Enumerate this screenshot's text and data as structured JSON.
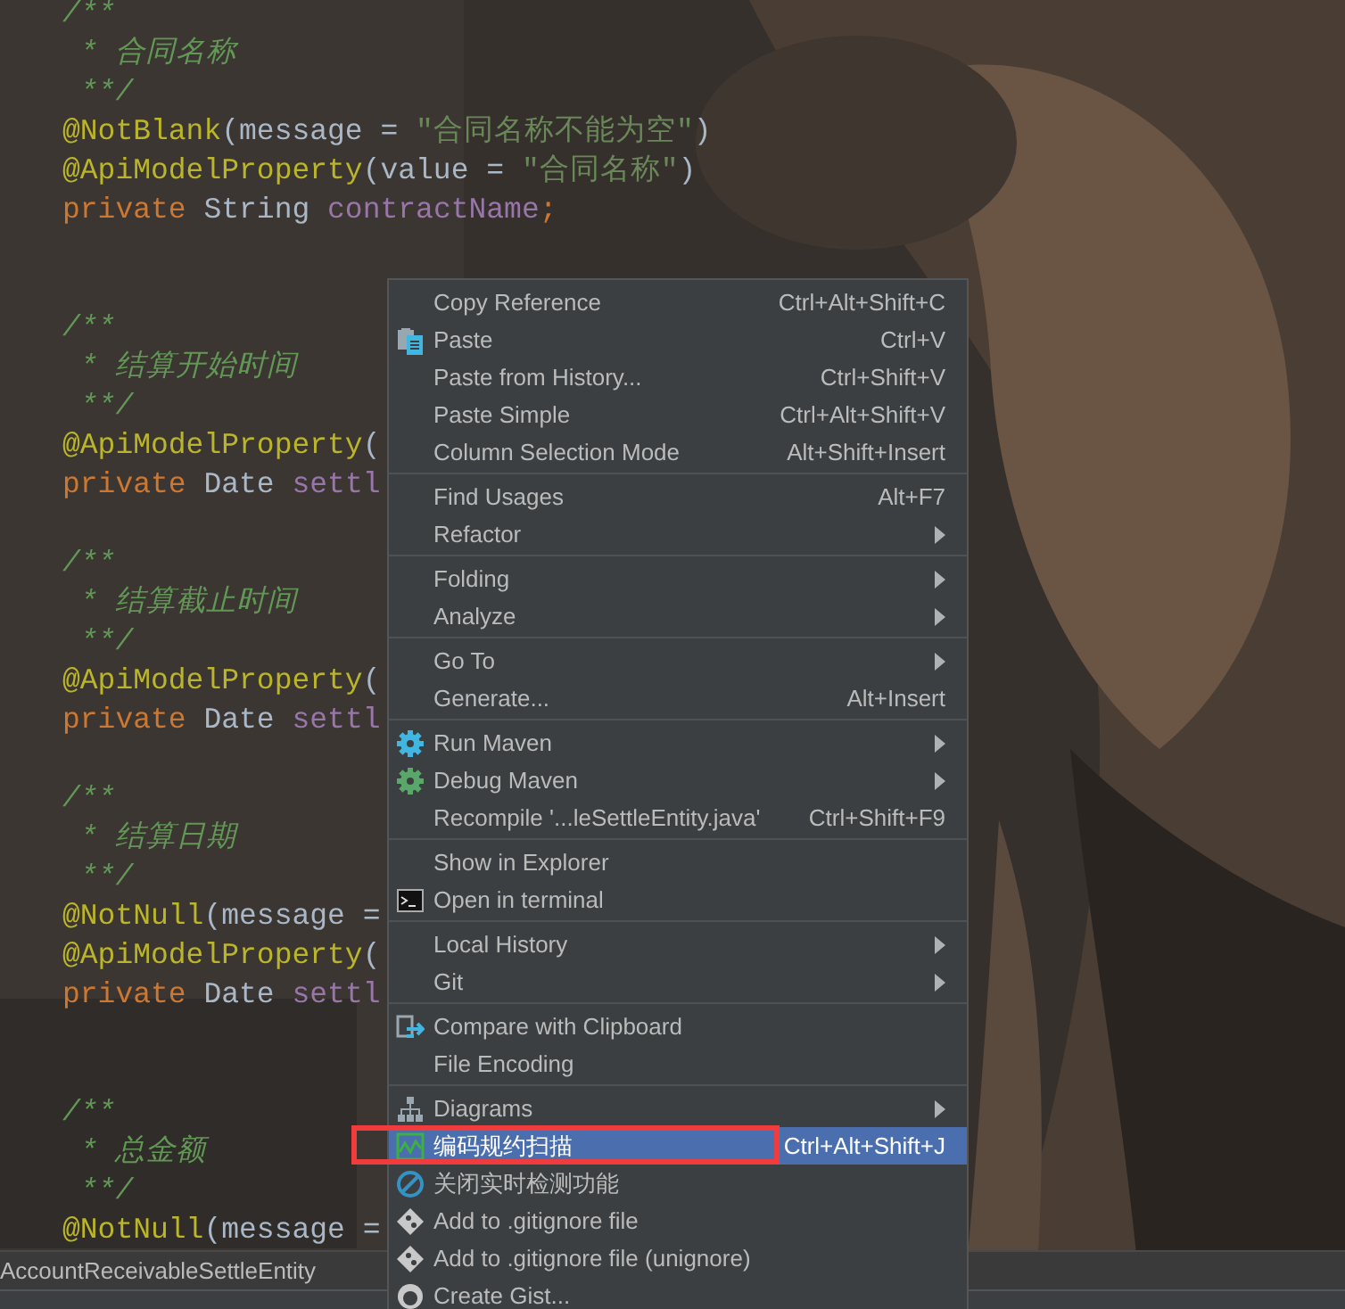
{
  "editor": {
    "lines": [
      {
        "kind": "code",
        "tokens": [
          {
            "kind": "comment",
            "text": "/**"
          }
        ]
      },
      {
        "kind": "code",
        "tokens": [
          {
            "kind": "comment",
            "text": " * 合同名称"
          }
        ]
      },
      {
        "kind": "code",
        "tokens": [
          {
            "kind": "comment",
            "text": " **/"
          }
        ]
      },
      {
        "kind": "code",
        "tokens": [
          {
            "kind": "annotation",
            "text": "@NotBlank"
          },
          {
            "kind": "plain",
            "text": "(message = "
          },
          {
            "kind": "string",
            "text": "\"合同名称不能为空\""
          },
          {
            "kind": "plain",
            "text": ")"
          }
        ]
      },
      {
        "kind": "code",
        "tokens": [
          {
            "kind": "annotation",
            "text": "@ApiModelProperty"
          },
          {
            "kind": "plain",
            "text": "(value = "
          },
          {
            "kind": "string",
            "text": "\"合同名称\""
          },
          {
            "kind": "plain",
            "text": ")"
          }
        ]
      },
      {
        "kind": "code",
        "tokens": [
          {
            "kind": "keyword",
            "text": "private "
          },
          {
            "kind": "plain",
            "text": "String "
          },
          {
            "kind": "field",
            "text": "contractName"
          },
          {
            "kind": "keyword",
            "text": ";"
          }
        ]
      },
      {
        "kind": "blank"
      },
      {
        "kind": "blank"
      },
      {
        "kind": "code",
        "tokens": [
          {
            "kind": "comment",
            "text": "/**"
          }
        ]
      },
      {
        "kind": "code",
        "tokens": [
          {
            "kind": "comment",
            "text": " * 结算开始时间"
          }
        ]
      },
      {
        "kind": "code",
        "tokens": [
          {
            "kind": "comment",
            "text": " **/"
          }
        ]
      },
      {
        "kind": "code",
        "tokens": [
          {
            "kind": "annotation",
            "text": "@ApiModelProperty"
          },
          {
            "kind": "plain",
            "text": "("
          }
        ]
      },
      {
        "kind": "code",
        "tokens": [
          {
            "kind": "keyword",
            "text": "private "
          },
          {
            "kind": "plain",
            "text": "Date "
          },
          {
            "kind": "field",
            "text": "settl"
          }
        ]
      },
      {
        "kind": "blank"
      },
      {
        "kind": "code",
        "tokens": [
          {
            "kind": "comment",
            "text": "/**"
          }
        ]
      },
      {
        "kind": "code",
        "tokens": [
          {
            "kind": "comment",
            "text": " * 结算截止时间"
          }
        ]
      },
      {
        "kind": "code",
        "tokens": [
          {
            "kind": "comment",
            "text": " **/"
          }
        ]
      },
      {
        "kind": "code",
        "tokens": [
          {
            "kind": "annotation",
            "text": "@ApiModelProperty"
          },
          {
            "kind": "plain",
            "text": "("
          }
        ]
      },
      {
        "kind": "code",
        "tokens": [
          {
            "kind": "keyword",
            "text": "private "
          },
          {
            "kind": "plain",
            "text": "Date "
          },
          {
            "kind": "field",
            "text": "settl"
          }
        ]
      },
      {
        "kind": "blank"
      },
      {
        "kind": "code",
        "tokens": [
          {
            "kind": "comment",
            "text": "/**"
          }
        ]
      },
      {
        "kind": "code",
        "tokens": [
          {
            "kind": "comment",
            "text": " * 结算日期"
          }
        ]
      },
      {
        "kind": "code",
        "tokens": [
          {
            "kind": "comment",
            "text": " **/"
          }
        ]
      },
      {
        "kind": "code",
        "tokens": [
          {
            "kind": "annotation",
            "text": "@NotNull"
          },
          {
            "kind": "plain",
            "text": "(message ="
          }
        ]
      },
      {
        "kind": "code",
        "tokens": [
          {
            "kind": "annotation",
            "text": "@ApiModelProperty"
          },
          {
            "kind": "plain",
            "text": "("
          }
        ]
      },
      {
        "kind": "code",
        "tokens": [
          {
            "kind": "keyword",
            "text": "private "
          },
          {
            "kind": "plain",
            "text": "Date "
          },
          {
            "kind": "field",
            "text": "settl"
          }
        ]
      },
      {
        "kind": "blank"
      },
      {
        "kind": "blank"
      },
      {
        "kind": "code",
        "tokens": [
          {
            "kind": "comment",
            "text": "/**"
          }
        ]
      },
      {
        "kind": "code",
        "tokens": [
          {
            "kind": "comment",
            "text": " * 总金额"
          }
        ]
      },
      {
        "kind": "code",
        "tokens": [
          {
            "kind": "comment",
            "text": " **/"
          }
        ]
      },
      {
        "kind": "code",
        "tokens": [
          {
            "kind": "annotation",
            "text": "@NotNull"
          },
          {
            "kind": "plain",
            "text": "(message ="
          }
        ]
      }
    ]
  },
  "breadcrumb": "AccountReceivableSettleEntity",
  "context_menu": {
    "items": [
      {
        "kind": "plain",
        "label": "Copy Reference",
        "shortcut": "Ctrl+Alt+Shift+C",
        "submenu": false,
        "selected": false
      },
      {
        "kind": "paste",
        "label": "Paste",
        "shortcut": "Ctrl+V",
        "submenu": false,
        "selected": false
      },
      {
        "kind": "plain",
        "label": "Paste from History...",
        "shortcut": "Ctrl+Shift+V",
        "submenu": false,
        "selected": false
      },
      {
        "kind": "plain",
        "label": "Paste Simple",
        "shortcut": "Ctrl+Alt+Shift+V",
        "submenu": false,
        "selected": false
      },
      {
        "kind": "plain",
        "label": "Column Selection Mode",
        "shortcut": "Alt+Shift+Insert",
        "submenu": false,
        "selected": false
      },
      {
        "kind": "separator"
      },
      {
        "kind": "plain",
        "label": "Find Usages",
        "shortcut": "Alt+F7",
        "submenu": false,
        "selected": false
      },
      {
        "kind": "plain",
        "label": "Refactor",
        "submenu": true,
        "selected": false
      },
      {
        "kind": "separator"
      },
      {
        "kind": "plain",
        "label": "Folding",
        "submenu": true,
        "selected": false
      },
      {
        "kind": "plain",
        "label": "Analyze",
        "submenu": true,
        "selected": false
      },
      {
        "kind": "separator"
      },
      {
        "kind": "plain",
        "label": "Go To",
        "submenu": true,
        "selected": false
      },
      {
        "kind": "plain",
        "label": "Generate...",
        "shortcut": "Alt+Insert",
        "submenu": false,
        "selected": false
      },
      {
        "kind": "separator"
      },
      {
        "kind": "run",
        "label": "Run Maven",
        "submenu": true,
        "selected": false
      },
      {
        "kind": "debug",
        "label": "Debug Maven",
        "submenu": true,
        "selected": false
      },
      {
        "kind": "plain",
        "label": "Recompile '...leSettleEntity.java'",
        "shortcut": "Ctrl+Shift+F9",
        "submenu": false,
        "selected": false
      },
      {
        "kind": "separator"
      },
      {
        "kind": "plain",
        "label": "Show in Explorer",
        "submenu": false,
        "selected": false
      },
      {
        "kind": "terminal",
        "label": "Open in terminal",
        "submenu": false,
        "selected": false
      },
      {
        "kind": "separator"
      },
      {
        "kind": "plain",
        "label": "Local History",
        "submenu": true,
        "selected": false
      },
      {
        "kind": "plain",
        "label": "Git",
        "submenu": true,
        "selected": false
      },
      {
        "kind": "separator"
      },
      {
        "kind": "compare",
        "label": "Compare with Clipboard",
        "submenu": false,
        "selected": false
      },
      {
        "kind": "plain",
        "label": "File Encoding",
        "submenu": false,
        "selected": false
      },
      {
        "kind": "separator"
      },
      {
        "kind": "diagrams",
        "label": "Diagrams",
        "submenu": true,
        "selected": false
      },
      {
        "kind": "scan",
        "label": "编码规约扫描",
        "shortcut": "Ctrl+Alt+Shift+J",
        "submenu": false,
        "selected": true,
        "highlighted": true
      },
      {
        "kind": "disable",
        "label": "关闭实时检测功能",
        "submenu": false,
        "selected": false
      },
      {
        "kind": "git",
        "label": "Add to .gitignore file",
        "submenu": false,
        "selected": false
      },
      {
        "kind": "git",
        "label": "Add to .gitignore file (unignore)",
        "submenu": false,
        "selected": false
      },
      {
        "kind": "gist",
        "label": "Create Gist...",
        "submenu": false,
        "selected": false
      }
    ]
  }
}
